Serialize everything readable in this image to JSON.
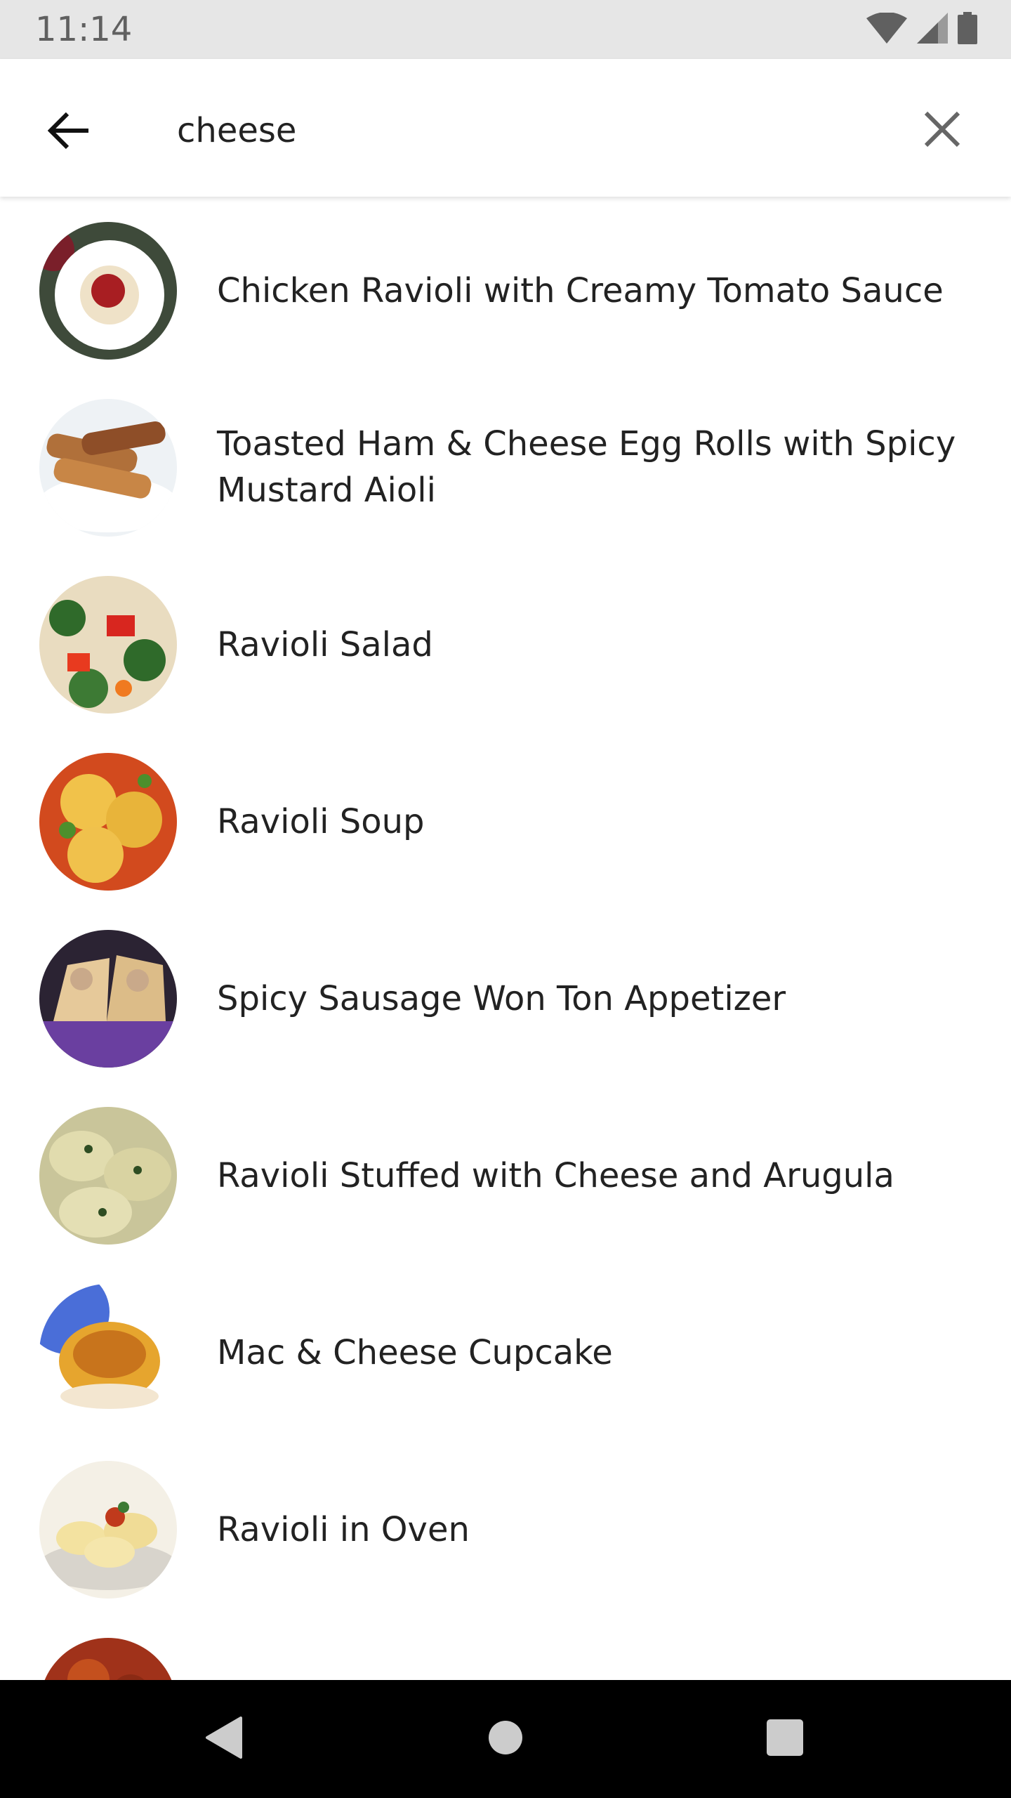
{
  "status_bar": {
    "time": "11:14",
    "icons": [
      "wifi-icon",
      "cell-signal-icon",
      "battery-icon"
    ]
  },
  "search": {
    "query": "cheese",
    "back_icon": "arrow-back-icon",
    "clear_icon": "close-icon"
  },
  "results": [
    {
      "title": "Chicken Ravioli with Creamy Tomato Sauce"
    },
    {
      "title": "Toasted Ham & Cheese Egg Rolls with Spicy Mustard Aioli"
    },
    {
      "title": "Ravioli Salad"
    },
    {
      "title": "Ravioli Soup"
    },
    {
      "title": "Spicy Sausage Won Ton Appetizer"
    },
    {
      "title": "Ravioli Stuffed with Cheese and Arugula"
    },
    {
      "title": "Mac & Cheese Cupcake"
    },
    {
      "title": "Ravioli in Oven"
    }
  ],
  "nav_bar": {
    "icons": [
      "back-triangle-icon",
      "home-circle-icon",
      "recents-square-icon"
    ]
  }
}
